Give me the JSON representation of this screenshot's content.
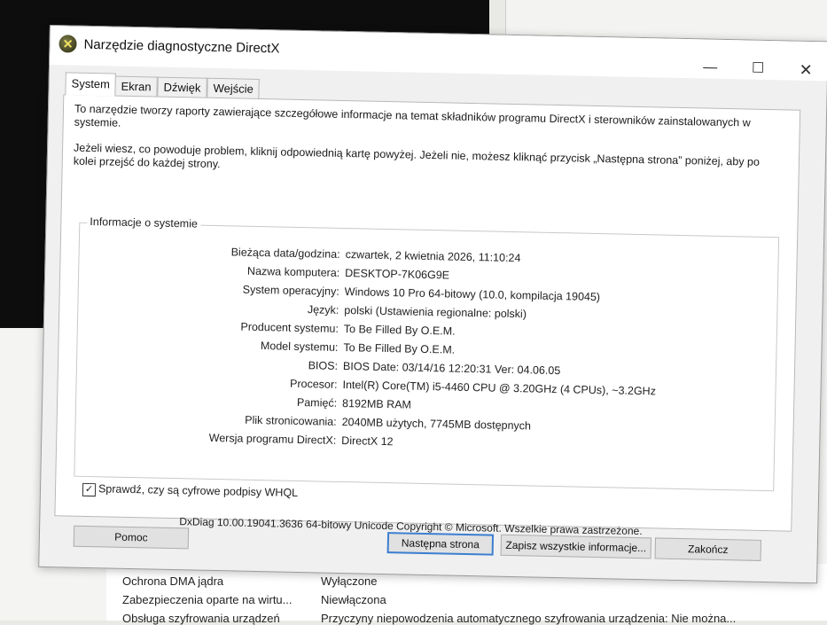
{
  "background": {
    "rows": [
      {
        "label": "Ochrona DMA jądra",
        "value": "Wyłączone"
      },
      {
        "label": "Zabezpieczenia oparte na wirtu...",
        "value": "Niewłączona"
      },
      {
        "label": "Obsługa szyfrowania urządzeń",
        "value": "Przyczyny niepowodzenia automatycznego szyfrowania urządzenia: Nie można..."
      }
    ]
  },
  "dialog": {
    "title": "Narzędzie diagnostyczne DirectX",
    "window_controls": {
      "minimize": "—",
      "maximize": "☐",
      "close": "✕"
    },
    "tabs": [
      {
        "label": "System",
        "active": true
      },
      {
        "label": "Ekran",
        "active": false
      },
      {
        "label": "Dźwięk",
        "active": false
      },
      {
        "label": "Wejście",
        "active": false
      }
    ],
    "intro1": "To narzędzie tworzy raporty zawierające szczegółowe informacje na temat składników programu DirectX i sterowników zainstalowanych w systemie.",
    "intro2": "Jeżeli wiesz, co powoduje problem, kliknij odpowiednią kartę powyżej. Jeżeli nie, możesz kliknąć przycisk „Następna strona” poniżej, aby po kolei przejść do każdej strony.",
    "group_title": "Informacje o systemie",
    "info": [
      {
        "label": "Bieżąca data/godzina:",
        "value": "czwartek, 2 kwietnia 2026, 11:10:24"
      },
      {
        "label": "Nazwa komputera:",
        "value": "DESKTOP-7K06G9E"
      },
      {
        "label": "System operacyjny:",
        "value": "Windows 10 Pro 64-bitowy (10.0, kompilacja 19045)"
      },
      {
        "label": "Język:",
        "value": "polski (Ustawienia regionalne: polski)"
      },
      {
        "label": "Producent systemu:",
        "value": "To Be Filled By O.E.M."
      },
      {
        "label": "Model systemu:",
        "value": "To Be Filled By O.E.M."
      },
      {
        "label": "BIOS:",
        "value": "BIOS Date: 03/14/16 12:20:31 Ver: 04.06.05"
      },
      {
        "label": "Procesor:",
        "value": "Intel(R) Core(TM) i5-4460  CPU @ 3.20GHz (4 CPUs), ~3.2GHz"
      },
      {
        "label": "Pamięć:",
        "value": "8192MB RAM"
      },
      {
        "label": "Plik stronicowania:",
        "value": "2040MB użytych, 7745MB dostępnych"
      },
      {
        "label": "Wersja programu DirectX:",
        "value": "DirectX 12"
      }
    ],
    "whql_checkbox": {
      "label": "Sprawdź, czy są cyfrowe podpisy WHQL",
      "checked": true,
      "mark": "✓"
    },
    "footer": "DxDiag 10.00.19041.3636 64-bitowy Unicode  Copyright © Microsoft. Wszelkie prawa zastrzeżone.",
    "buttons": {
      "help": "Pomoc",
      "next": "Następna strona",
      "save": "Zapisz wszystkie informacje...",
      "exit": "Zakończ"
    },
    "colors": {
      "default_button_border": "#3c7fd1"
    }
  }
}
